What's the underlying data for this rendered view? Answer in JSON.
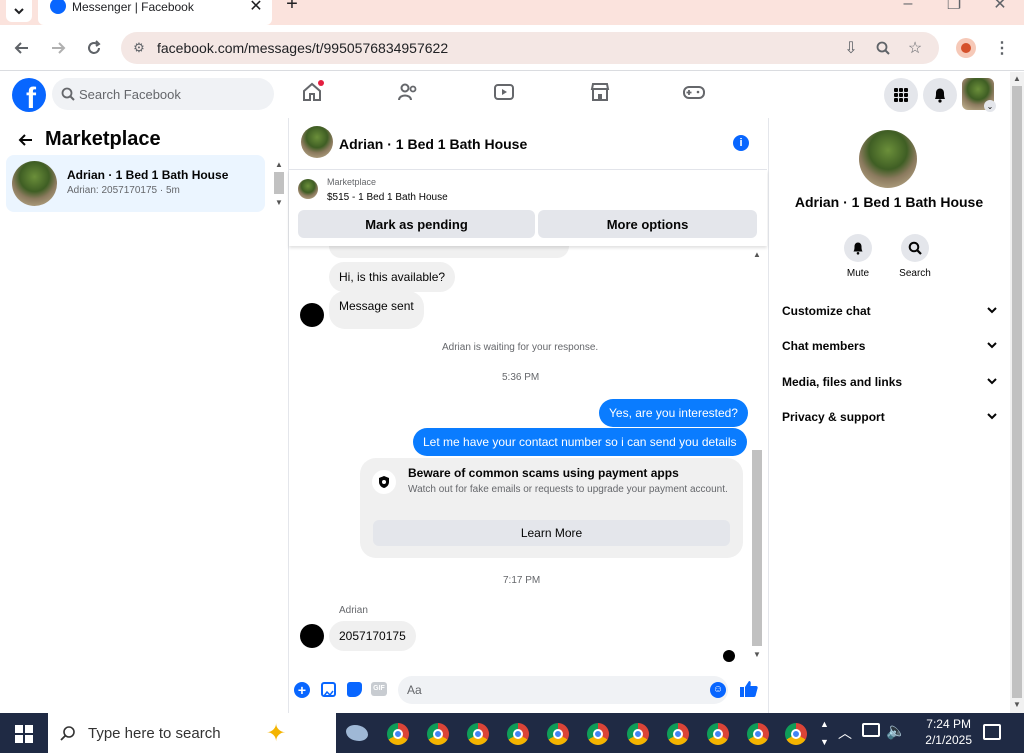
{
  "browser": {
    "tab_title": "Messenger | Facebook",
    "url": "facebook.com/messages/t/9950576834957622"
  },
  "fb_header": {
    "logo": "f",
    "search_placeholder": "Search Facebook",
    "nav_icons": [
      "home-icon",
      "friends-icon",
      "video-icon",
      "marketplace-icon",
      "gaming-icon"
    ],
    "accent": "#0866ff"
  },
  "left_panel": {
    "title": "Marketplace",
    "conversations": [
      {
        "name": "Adrian · 1 Bed 1 Bath House",
        "preview": "Adrian: 2057170175 · 5m"
      }
    ]
  },
  "chat": {
    "title": "Adrian · 1 Bed 1 Bath House",
    "marketplace_label": "Marketplace",
    "listing": "$515 - 1 Bed 1 Bath House",
    "mark_pending_label": "Mark as pending",
    "more_options_label": "More options",
    "messages": {
      "msg1": "Hi, is this available?",
      "msg2": "Message sent",
      "waiting": "Adrian is waiting for your response.",
      "time1": "5:36 PM",
      "out1": "Yes, are you interested?",
      "out2": "Let me have your contact number so i can send you details",
      "scam_title": "Beware of common scams using payment apps",
      "scam_body": "Watch out for fake emails or requests to upgrade your payment account.",
      "learn_more": "Learn More",
      "time2": "7:17 PM",
      "sender": "Adrian",
      "msg3": "2057170175"
    },
    "composer_placeholder": "Aa",
    "bubble_out_color": "#0a7cff"
  },
  "right_panel": {
    "title": "Adrian · 1 Bed 1 Bath House",
    "mute_label": "Mute",
    "search_label": "Search",
    "rows": [
      "Customize chat",
      "Chat members",
      "Media, files and links",
      "Privacy & support"
    ]
  },
  "taskbar": {
    "search_placeholder": "Type here to search",
    "time": "7:24 PM",
    "date": "2/1/2025"
  }
}
